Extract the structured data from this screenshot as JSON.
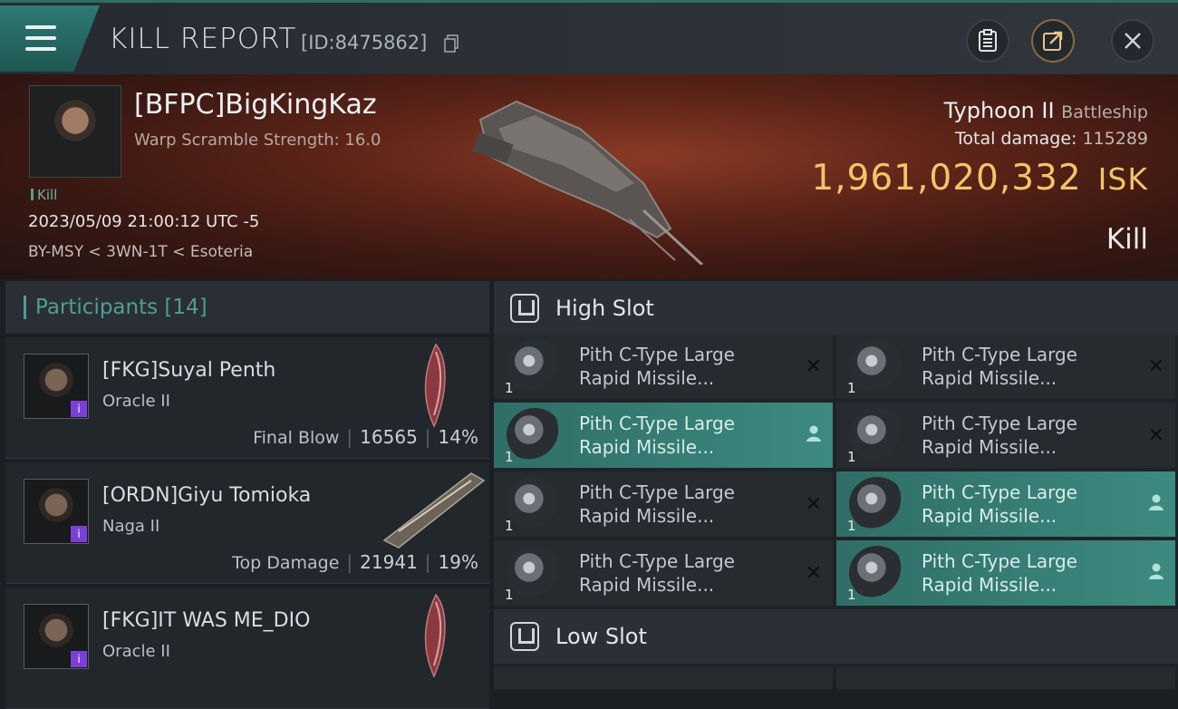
{
  "header": {
    "title": "KILL REPORT",
    "report_id": "[ID:8475862]"
  },
  "victim": {
    "name": "[BFPC]BigKingKaz",
    "subtitle": "Warp Scramble Strength: 16.0",
    "tag": "Kill",
    "timestamp": "2023/05/09 21:00:12 UTC -5",
    "location": "BY-MSY < 3WN-1T < Esoteria",
    "ship_name": "Typhoon II",
    "ship_class": "Battleship",
    "total_damage_label": "Total damage:",
    "total_damage": "115289",
    "isk_value": "1,961,020,332",
    "isk_unit": "ISK",
    "result": "Kill"
  },
  "participants": {
    "label": "Participants",
    "count": "[14]",
    "items": [
      {
        "name": "[FKG]Suyal Penth",
        "ship": "Oracle II",
        "role": "Final Blow",
        "damage": "16565",
        "percent": "14%"
      },
      {
        "name": "[ORDN]Giyu Tomioka",
        "ship": "Naga II",
        "role": "Top Damage",
        "damage": "21941",
        "percent": "19%"
      },
      {
        "name": "[FKG]IT WAS ME_DIO",
        "ship": "Oracle II"
      }
    ]
  },
  "slots": {
    "high_label": "High Slot",
    "low_label": "Low Slot",
    "high_modules": [
      {
        "line1": "Pith C-Type Large",
        "line2": "Rapid Missile...",
        "qty": "1",
        "status": "destroyed"
      },
      {
        "line1": "Pith C-Type Large",
        "line2": "Rapid Missile...",
        "qty": "1",
        "status": "destroyed"
      },
      {
        "line1": "Pith C-Type Large",
        "line2": "Rapid Missile...",
        "qty": "1",
        "status": "dropped"
      },
      {
        "line1": "Pith C-Type Large",
        "line2": "Rapid Missile...",
        "qty": "1",
        "status": "destroyed"
      },
      {
        "line1": "Pith C-Type Large",
        "line2": "Rapid Missile...",
        "qty": "1",
        "status": "destroyed"
      },
      {
        "line1": "Pith C-Type Large",
        "line2": "Rapid Missile...",
        "qty": "1",
        "status": "dropped"
      },
      {
        "line1": "Pith C-Type Large",
        "line2": "Rapid Missile...",
        "qty": "1",
        "status": "destroyed"
      },
      {
        "line1": "Pith C-Type Large",
        "line2": "Rapid Missile...",
        "qty": "1",
        "status": "dropped"
      }
    ]
  },
  "icons": {
    "destroyed": "✕",
    "dropped": "person-icon"
  },
  "colors": {
    "accent": "#4f9d96",
    "isk": "#f2c46a",
    "highlight": "#3d8a80",
    "badge": "#7b3fd8"
  }
}
